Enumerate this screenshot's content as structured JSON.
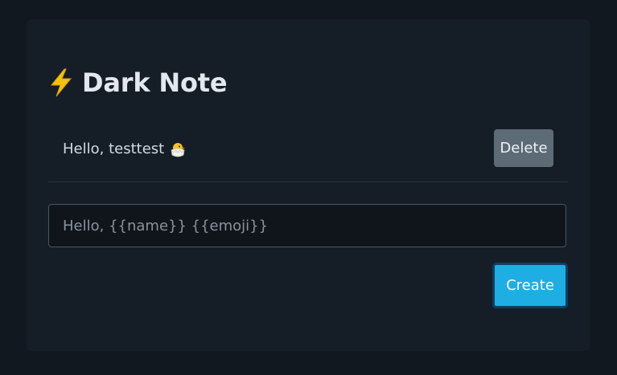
{
  "app": {
    "title": "Dark Note",
    "title_icon": "lightning-bolt-icon"
  },
  "notes": [
    {
      "text": "Hello, testtest",
      "emoji_icon": "hatching-chick-icon",
      "delete_label": "Delete"
    }
  ],
  "composer": {
    "value": "",
    "placeholder": "Hello, {{name}} {{emoji}}",
    "create_label": "Create"
  },
  "colors": {
    "background": "#12181f",
    "card": "#151e27",
    "accent": "#1eaee3",
    "delete_button": "#5d6b77",
    "bolt": "#f4c20d"
  }
}
